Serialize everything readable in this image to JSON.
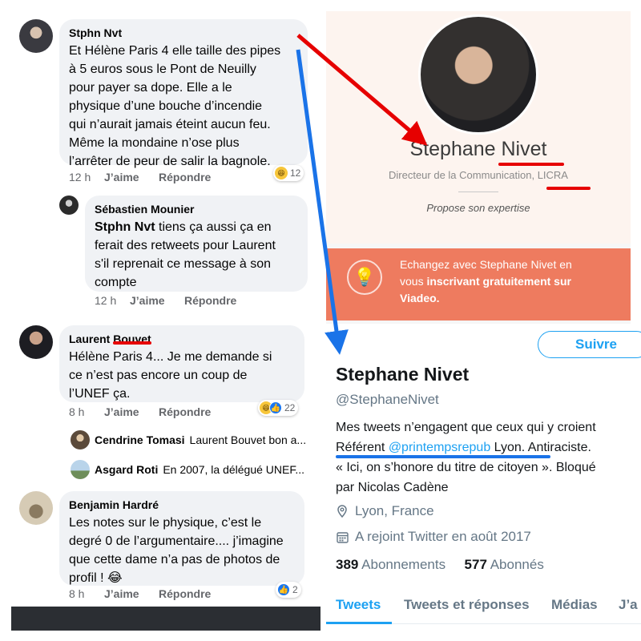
{
  "facebook": {
    "comments": [
      {
        "author": "Stphn Nvt",
        "text": "Et Hélène Paris 4 elle taille des pipes\nà 5 euros sous le Pont de Neuilly\npour payer sa dope. Elle a le\nphysique d’une bouche d’incendie\nqui n’aurait jamais éteint aucun feu.\nMême la mondaine n’ose plus\nl’arrêter de peur de salir la bagnole.",
        "time": "12 h",
        "like": "J’aime",
        "reply": "Répondre",
        "reaction_count": "12"
      },
      {
        "author": "Sébastien Mounier",
        "mention": "Stphn Nvt",
        "text": " tiens ça aussi ça en\nferait des retweets pour Laurent\ns'il reprenait ce message à son\ncompte",
        "time": "12 h",
        "like": "J’aime",
        "reply": "Répondre"
      },
      {
        "author": "Laurent Bouvet",
        "text": "Hélène Paris 4... Je me demande si\nce n’est pas encore un coup de\nl’UNEF ça.",
        "time": "8 h",
        "like": "J’aime",
        "reply": "Répondre",
        "reaction_count": "22"
      },
      {
        "author": "Benjamin Hardré",
        "text": "Les notes sur le physique, c’est le\ndegré 0 de l’argumentaire.... j’imagine\nque cette dame n’a pas de photos de\nprofil ! 😂",
        "time": "8 h",
        "like": "J’aime",
        "reply": "Répondre",
        "reaction_count": "2"
      }
    ],
    "replies": [
      {
        "name": "Cendrine Tomasi",
        "text": "Laurent Bouvet bon a..."
      },
      {
        "name": "Asgard Roti",
        "text": "En  2007, la délégué UNEF..."
      }
    ]
  },
  "viadeo": {
    "name": "Stephane Nivet",
    "role": "Directeur de la Communication, LICRA",
    "expertise": "Propose son expertise",
    "cta_line1": "Echangez avec Stephane Nivet en",
    "cta_line2_plain": "vous ",
    "cta_line2_bold": "inscrivant gratuitement sur",
    "cta_line3_bold": "Viadeo.",
    "icon": "lightbulb-icon"
  },
  "twitter": {
    "follow_label": "Suivre",
    "name": "Stephane Nivet",
    "handle": "@StephaneNivet",
    "bio_line1": "Mes tweets n’engagent que ceux qui y croient",
    "bio_line2_a": "Référent ",
    "bio_line2_mention": "@printempsrepub",
    "bio_line2_b": " Lyon. Antiraciste.",
    "bio_line3": "« Ici, on s’honore du titre de citoyen ». Bloqué",
    "bio_line4": "par Nicolas Cadène",
    "location": "Lyon, France",
    "joined": "A rejoint Twitter en août 2017",
    "following_count": "389",
    "following_label": "Abonnements",
    "followers_count": "577",
    "followers_label": "Abonnés",
    "tabs": [
      "Tweets",
      "Tweets et réponses",
      "Médias",
      "J’a"
    ]
  },
  "colors": {
    "annotation_red": "#e60000",
    "annotation_blue": "#1a73e8",
    "twitter_blue": "#1da1f2",
    "viadeo_orange": "#ee7b5f"
  }
}
